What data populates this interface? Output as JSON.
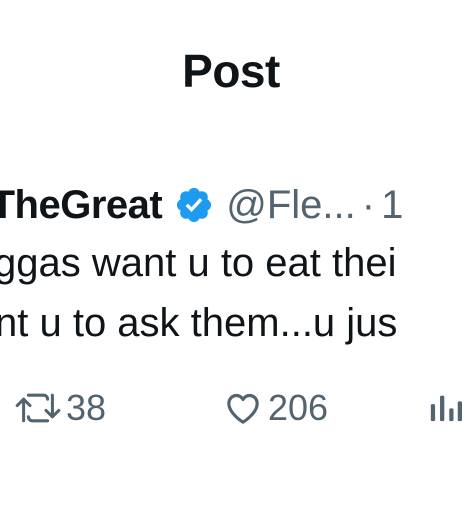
{
  "header": {
    "title": "Post"
  },
  "tweet": {
    "display_name": "lTheGreat",
    "handle": "@Fle...",
    "separator": "·",
    "time": "1",
    "lines": [
      "ggas want u to eat thei",
      "nt u to ask them...u jus"
    ]
  },
  "actions": {
    "retweet_count": "38",
    "like_count": "206"
  },
  "icons": {
    "verified": "verified-badge-icon",
    "retweet": "retweet-icon",
    "like": "heart-icon",
    "views": "views-chart-icon"
  },
  "colors": {
    "text_primary": "#0f1419",
    "text_secondary": "#536471",
    "verified_blue": "#1d9bf0",
    "background": "#ffffff"
  }
}
